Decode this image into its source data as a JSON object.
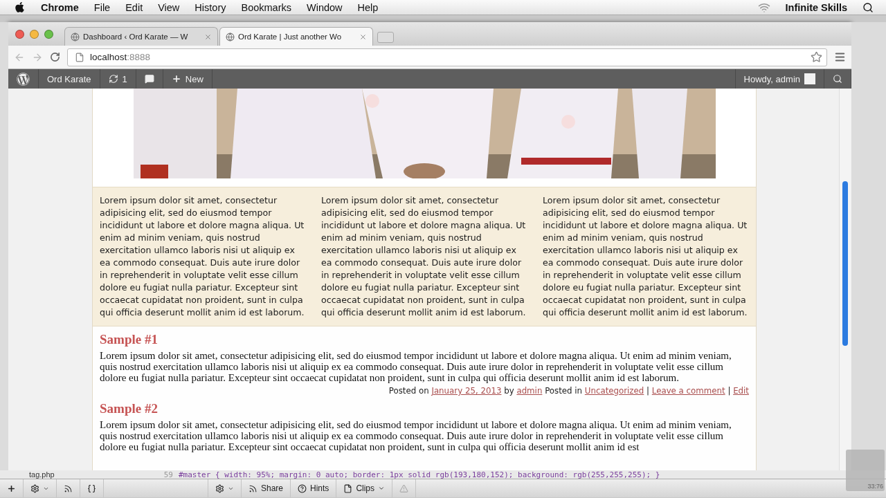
{
  "menu_bar": {
    "app": "Chrome",
    "menus": [
      "File",
      "Edit",
      "View",
      "History",
      "Bookmarks",
      "Window",
      "Help"
    ],
    "status_text": "Infinite Skills"
  },
  "browser": {
    "tabs": [
      {
        "title": "Dashboard ‹ Ord Karate — W",
        "selected": false
      },
      {
        "title": "Ord Karate | Just another Wo",
        "selected": true
      }
    ],
    "address": {
      "host": "localhost",
      "port": ":8888"
    }
  },
  "admin_bar": {
    "site": "Ord Karate",
    "updates": "1",
    "new": "New",
    "greeting": "Howdy, admin"
  },
  "page": {
    "columns": [
      "Lorem ipsum dolor sit amet, consectetur adipisicing elit, sed do eiusmod tempor incididunt ut labore et dolore magna aliqua. Ut enim ad minim veniam, quis nostrud exercitation ullamco laboris nisi ut aliquip ex ea commodo consequat. Duis aute irure dolor in reprehenderit in voluptate velit esse cillum dolore eu fugiat nulla pariatur. Excepteur sint occaecat cupidatat non proident, sunt in culpa qui officia deserunt mollit anim id est laborum.",
      "Lorem ipsum dolor sit amet, consectetur adipisicing elit, sed do eiusmod tempor incididunt ut labore et dolore magna aliqua. Ut enim ad minim veniam, quis nostrud exercitation ullamco laboris nisi ut aliquip ex ea commodo consequat. Duis aute irure dolor in reprehenderit in voluptate velit esse cillum dolore eu fugiat nulla pariatur. Excepteur sint occaecat cupidatat non proident, sunt in culpa qui officia deserunt mollit anim id est laborum.",
      "Lorem ipsum dolor sit amet, consectetur adipisicing elit, sed do eiusmod tempor incididunt ut labore et dolore magna aliqua. Ut enim ad minim veniam, quis nostrud exercitation ullamco laboris nisi ut aliquip ex ea commodo consequat. Duis aute irure dolor in reprehenderit in voluptate velit esse cillum dolore eu fugiat nulla pariatur. Excepteur sint occaecat cupidatat non proident, sunt in culpa qui officia deserunt mollit anim id est laborum."
    ],
    "posts": [
      {
        "title": "Sample #1",
        "body": "Lorem ipsum dolor sit amet, consectetur adipisicing elit, sed do eiusmod tempor incididunt ut labore et dolore magna aliqua. Ut enim ad minim veniam, quis nostrud exercitation ullamco laboris nisi ut aliquip ex ea commodo consequat. Duis aute irure dolor in reprehenderit in voluptate velit esse cillum dolore eu fugiat nulla pariatur. Excepteur sint occaecat cupidatat non proident, sunt in culpa qui officia deserunt mollit anim id est laborum.",
        "meta": {
          "posted_on": "Posted on",
          "date": "January 25, 2013",
          "by": "by",
          "author": "admin",
          "posted_in": "Posted in",
          "category": "Uncategorized",
          "separators": [
            "|",
            "|"
          ],
          "comment_link": "Leave a comment",
          "edit_link": "Edit"
        }
      },
      {
        "title": "Sample #2",
        "body": "Lorem ipsum dolor sit amet, consectetur adipisicing elit, sed do eiusmod tempor incididunt ut labore et dolore magna aliqua. Ut enim ad minim veniam, quis nostrud exercitation ullamco laboris nisi ut aliquip ex ea commodo consequat. Duis aute irure dolor in reprehenderit in voluptate velit esse cillum dolore eu fugiat nulla pariatur. Excepteur sint occaecat cupidatat non proident, sunt in culpa qui officia deserunt mollit anim id est"
      }
    ]
  },
  "editor": {
    "file": "tag.php",
    "line_number": "59",
    "code": "#master { width: 95%; margin: 0 auto; border: 1px solid rgb(193,180,152); background: rgb(255,255,255); }",
    "toolbar": [
      "Share",
      "Hints",
      "Clips"
    ],
    "timer": "33:76"
  }
}
